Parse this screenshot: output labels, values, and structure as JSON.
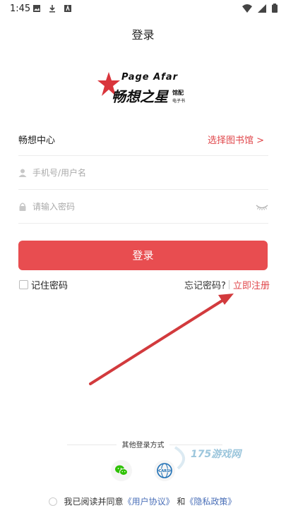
{
  "status_bar": {
    "time": "1:45"
  },
  "header": {
    "title": "登录"
  },
  "logo": {
    "english": "Page Afar",
    "chinese": "畅想之星",
    "side_top": "馆配",
    "side_bottom": "电子书"
  },
  "library_row": {
    "label": "畅想中心",
    "select_label": "选择图书馆 >"
  },
  "username_field": {
    "placeholder": "手机号/用户名",
    "value": ""
  },
  "password_field": {
    "placeholder": "请输入密码",
    "value": ""
  },
  "login_button": {
    "label": "登录"
  },
  "remember": {
    "label": "记住密码"
  },
  "forgot": {
    "label": "忘记密码?"
  },
  "register": {
    "label": "立即注册"
  },
  "other_login": {
    "label": "其他登录方式"
  },
  "agreement": {
    "prefix": "我已阅读并同意",
    "user_agreement": "《用户协议》",
    "and": "和",
    "privacy_policy": "《隐私政策》"
  },
  "watermark": {
    "text": "175游戏网"
  },
  "colors": {
    "accent": "#e84d50",
    "link": "#4a6fb8",
    "wechat": "#2dc100",
    "carsi": "#1e6fb5"
  }
}
